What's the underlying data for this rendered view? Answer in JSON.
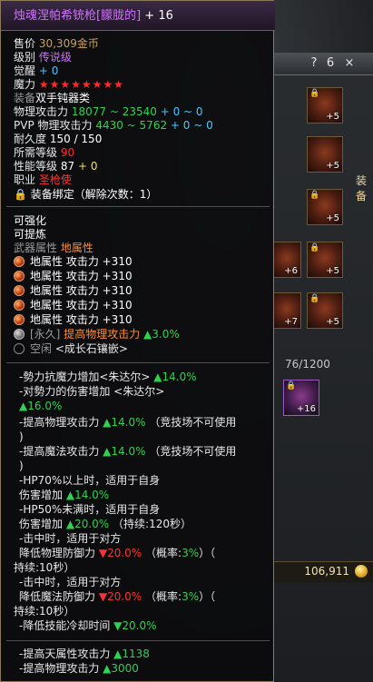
{
  "item": {
    "name": "烛魂涅帕希铳枪[朦胧的]",
    "enhance": "+ 16",
    "price_label": "售价",
    "price_value": "30,309金币",
    "level_label": "级别",
    "level_value": "传说级",
    "awaken_label": "觉醒",
    "awaken_value": "+ 0",
    "magic_label": "魔力",
    "magic_stars": "★★★★★★★★",
    "equip_label": "装备",
    "equip_value": "双手钝器类",
    "phys_atk_label": "物理攻击力",
    "phys_atk_value": "18077 ~ 23540",
    "phys_atk_bonus": "+ 0 ~ 0",
    "pvp_label": "PVP 物理攻击力",
    "pvp_value": "4430 ~ 5762",
    "pvp_bonus": "+ 0 ~ 0",
    "durability_label": "耐久度",
    "durability_value": "150 / 150",
    "req_level_label": "所需等级",
    "req_level_value": "90",
    "perf_level_label": "性能等级",
    "perf_level_value": "87",
    "perf_level_bonus": "+ 0",
    "job_label": "职业",
    "job_value": "圣枪使",
    "bind_text": "装备绑定（解除次数：1）"
  },
  "props": {
    "can_enhance": "可强化",
    "can_refine": "可提炼",
    "weapon_attr_label": "武器属性",
    "weapon_attr_value": "地属性",
    "earth_lines": [
      "地属性 攻击力 +310",
      "地属性 攻击力 +310",
      "地属性 攻击力 +310",
      "地属性 攻击力 +310",
      "地属性 攻击力 +310"
    ],
    "perm_tag": "[永久]",
    "perm_text": "提高物理攻击力",
    "perm_value": "▲3.0%",
    "socket_empty": "空闲",
    "socket_text": "<成长石镶嵌>"
  },
  "effects": [
    {
      "text": "-勢力抗魔力增加<朱达尔>",
      "value": "▲14.0%"
    },
    {
      "text": "-对勢力的伤害增加 <朱达尔>",
      "value": ""
    },
    {
      "text": "",
      "value": "▲16.0%"
    },
    {
      "text": "-提高物理攻击力",
      "value": "▲14.0%",
      "tail": "（竞技场不可使用"
    },
    {
      "text": ")",
      "value": ""
    },
    {
      "text": "-提高魔法攻击力",
      "value": "▲14.0%",
      "tail": "（竞技场不可使用"
    },
    {
      "text": ")",
      "value": ""
    },
    {
      "text": "-HP70%以上时，适用于自身",
      "value": ""
    },
    {
      "text": " 伤害增加",
      "value": "▲14.0%"
    },
    {
      "text": "-HP50%未满时，适用于自身",
      "value": ""
    },
    {
      "text": " 伤害增加",
      "value": "▲20.0%",
      "tail": "（持续:120秒）"
    },
    {
      "text": "-击中时，适用于对方",
      "value": ""
    },
    {
      "text": " 降低物理防御力",
      "value": "▼20.0%",
      "tail": "（概率:",
      "tail_val": "3%",
      "tail2": "）（"
    },
    {
      "text": "持续:10秒）",
      "value": ""
    },
    {
      "text": "-击中时，适用于对方",
      "value": ""
    },
    {
      "text": " 降低魔法防御力",
      "value": "▼20.0%",
      "tail": "（概率:",
      "tail_val": "3%",
      "tail2": "）（"
    },
    {
      "text": "持续:10秒）",
      "value": ""
    },
    {
      "text": " -降低技能冷却时间",
      "value": "▼20.0%"
    }
  ],
  "bottom": [
    {
      "text": "-提高天属性攻击力",
      "value": "▲1138"
    },
    {
      "text": "-提高物理攻击力",
      "value": "▲3000"
    }
  ],
  "side": {
    "top_buttons": [
      "?",
      "6",
      "×"
    ],
    "equip_label": "装备",
    "slot_labels": [
      "+5",
      "+5",
      "+5",
      "+6",
      "+5",
      "+7",
      "+5"
    ],
    "tab_text": "76/1200",
    "purple_slot": "+16",
    "gold": "106,911"
  }
}
